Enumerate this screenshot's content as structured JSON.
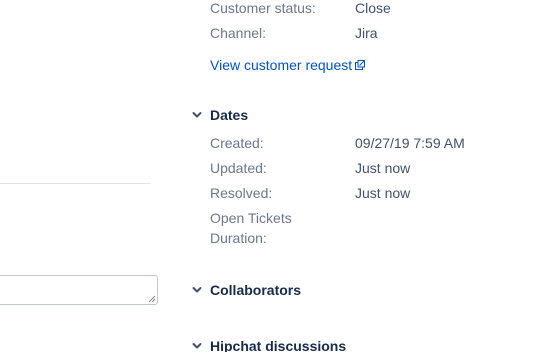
{
  "customer": {
    "status_label": "Customer status:",
    "status_value": "Close",
    "channel_label": "Channel:",
    "channel_value": "Jira",
    "view_request_link": "View customer request"
  },
  "dates": {
    "title": "Dates",
    "created_label": "Created:",
    "created_value": "09/27/19 7:59 AM",
    "updated_label": "Updated:",
    "updated_value": "Just now",
    "resolved_label": "Resolved:",
    "resolved_value": "Just now",
    "open_duration_label": "Open Tickets Duration:"
  },
  "sections": {
    "collaborators_title": "Collaborators",
    "hipchat_title": "Hipchat discussions"
  },
  "colors": {
    "label": "#6b778c",
    "value": "#42526e",
    "link": "#0052cc",
    "heading": "#172b4d"
  },
  "icons": {
    "external_link": "external-link-icon",
    "chevron": "chevron-down-icon"
  }
}
